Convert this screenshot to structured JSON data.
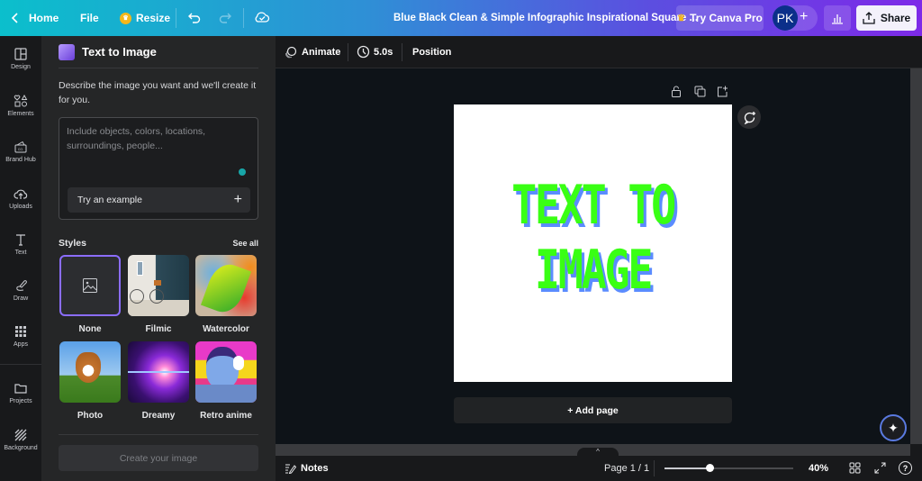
{
  "topbar": {
    "home_label": "Home",
    "file_label": "File",
    "resize_label": "Resize",
    "document_title": "Blue Black Clean & Simple Infographic Inspirational Square ...",
    "try_pro_label": "Try Canva Pro",
    "avatar_initials": "PK",
    "share_label": "Share"
  },
  "rail": {
    "items": [
      {
        "label": "Design",
        "icon": "layout-icon"
      },
      {
        "label": "Elements",
        "icon": "shapes-icon"
      },
      {
        "label": "Brand Hub",
        "icon": "brand-icon"
      },
      {
        "label": "Uploads",
        "icon": "cloud-upload-icon"
      },
      {
        "label": "Text",
        "icon": "text-icon"
      },
      {
        "label": "Draw",
        "icon": "pen-icon"
      },
      {
        "label": "Apps",
        "icon": "grid-icon"
      },
      {
        "label": "Projects",
        "icon": "folder-icon"
      },
      {
        "label": "Background",
        "icon": "hatch-icon"
      }
    ]
  },
  "panel": {
    "title": "Text to Image",
    "description": "Describe the image you want and we'll create it for you.",
    "prompt_placeholder": "Include objects, colors, locations, surroundings, people...",
    "prompt_value": "",
    "try_example_label": "Try an example",
    "styles_heading": "Styles",
    "see_all_label": "See all",
    "styles": [
      {
        "label": "None",
        "selected": true
      },
      {
        "label": "Filmic",
        "selected": false
      },
      {
        "label": "Watercolor",
        "selected": false
      },
      {
        "label": "Photo",
        "selected": false
      },
      {
        "label": "Dreamy",
        "selected": false
      },
      {
        "label": "Retro anime",
        "selected": false
      }
    ],
    "create_label": "Create your image"
  },
  "editor": {
    "animate_label": "Animate",
    "duration_label": "5.0s",
    "position_label": "Position",
    "design_text_line1": "TEXT TO",
    "design_text_line2": "IMAGE",
    "add_page_label": "+ Add page"
  },
  "bottombar": {
    "notes_label": "Notes",
    "page_label": "Page 1 / 1",
    "zoom_label": "40%",
    "zoom_fraction": 0.35
  },
  "colors": {
    "accent_purple": "#8b3dff",
    "design_text_green": "#39ff14",
    "design_text_shadow": "#5b8cff",
    "teal_dot": "#18a6a8"
  }
}
